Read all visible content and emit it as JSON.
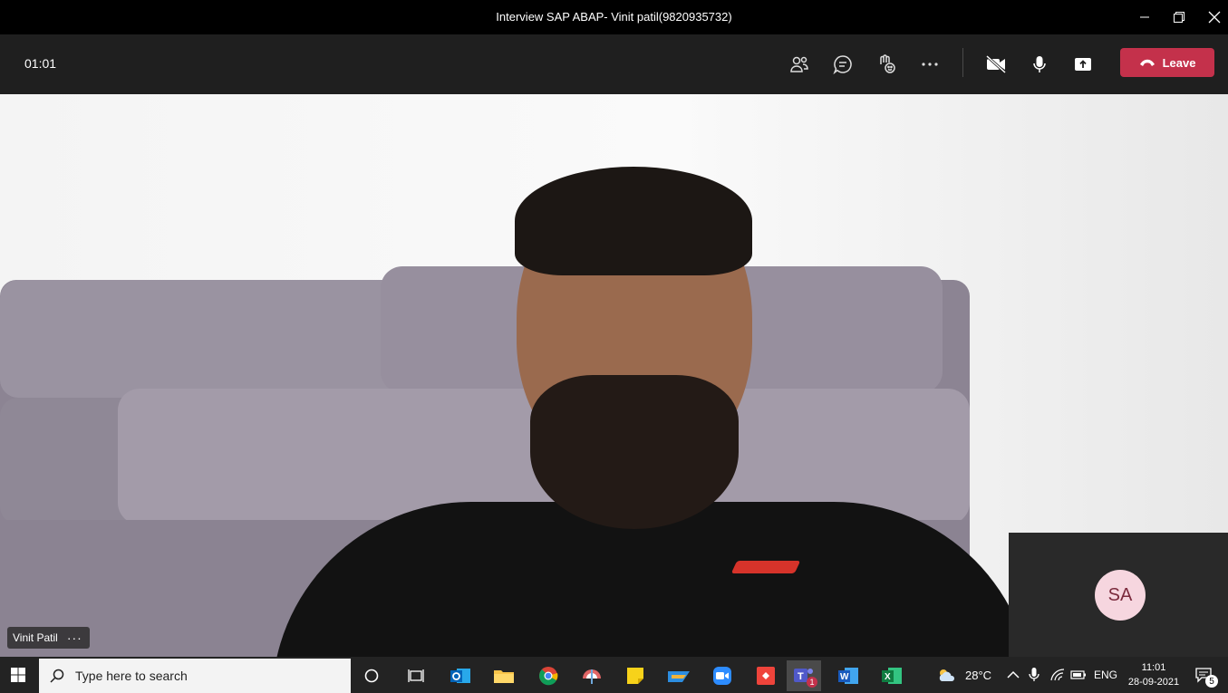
{
  "window": {
    "title": "Interview SAP ABAP- Vinit patil(9820935732)"
  },
  "toolbar": {
    "timer": "01:01",
    "leave_label": "Leave",
    "icons": [
      "participants-icon",
      "chat-icon",
      "reactions-icon",
      "more-icon",
      "camera-off-icon",
      "mic-icon",
      "share-icon",
      "phone-icon"
    ]
  },
  "video": {
    "participant_name": "Vinit Patil",
    "more_label": "···",
    "selfview_initials": "SA"
  },
  "taskbar": {
    "search_placeholder": "Type here to search",
    "weather": "28°C",
    "language": "ENG",
    "time": "11:01",
    "date": "28-09-2021",
    "teams_badge": "1",
    "notification_count": "5"
  },
  "colors": {
    "leave": "#c4314b",
    "toolbar_bg": "#1f1f1f",
    "avatar_bg": "#f6d6df",
    "avatar_text": "#7b2b3d"
  }
}
